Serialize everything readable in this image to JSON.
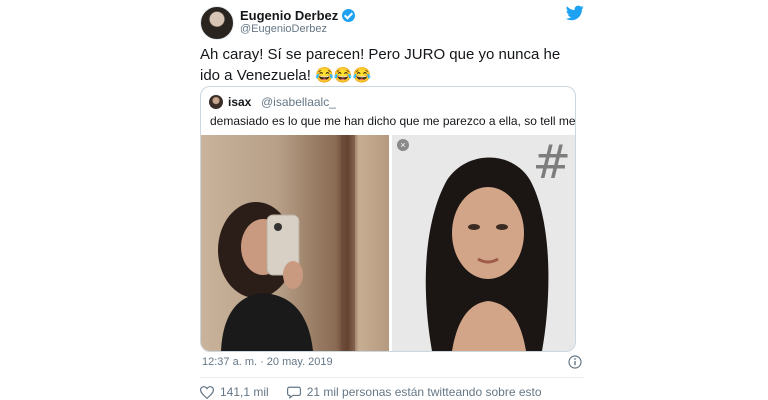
{
  "author": {
    "name": "Eugenio Derbez",
    "handle": "@EugenioDerbez"
  },
  "tweet": {
    "text": "Ah caray! Sí se parecen! Pero JURO que yo nunca he ido a Venezuela!",
    "emoji": "😂😂😂"
  },
  "quote": {
    "name": "isax",
    "handle": "@isabellaalc_",
    "text": "demasiado es lo que me han dicho que me parezco a ella, so tell me",
    "watermark": "#",
    "close_glyph": "×"
  },
  "meta": {
    "timestamp": "12:37 a. m. · 20 may. 2019"
  },
  "actions": {
    "likes": "141,1 mil",
    "conversation": "21 mil personas están twitteando sobre esto"
  },
  "colors": {
    "twitter_blue": "#1da1f2",
    "muted_text": "#657786",
    "border": "#ccd6dd"
  },
  "icons": {
    "bird": "twitter-bird-icon",
    "verified": "verified-badge-icon",
    "info": "info-icon",
    "heart": "heart-icon",
    "comment": "comment-icon"
  }
}
